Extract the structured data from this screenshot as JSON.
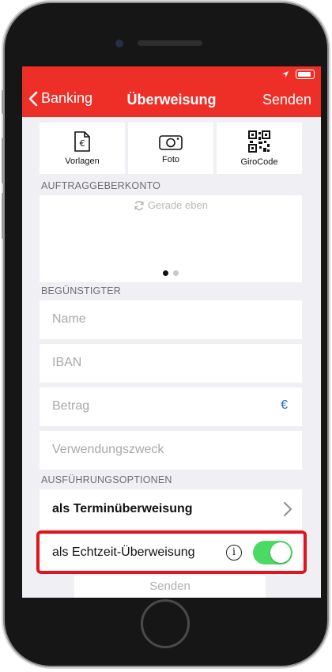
{
  "nav": {
    "back_label": "Banking",
    "title": "Überweisung",
    "send_label": "Senden"
  },
  "tiles": [
    {
      "label": "Vorlagen",
      "icon": "document-euro-icon"
    },
    {
      "label": "Foto",
      "icon": "camera-icon"
    },
    {
      "label": "GiroCode",
      "icon": "qr-code-icon"
    }
  ],
  "sections": {
    "account": "AUFTRAGGEBERKONTO",
    "beneficiary": "BEGÜNSTIGTER",
    "options": "AUSFÜHRUNGSOPTIONEN"
  },
  "account": {
    "sync_text": "Gerade eben",
    "page_count": 2,
    "active_page": 1
  },
  "fields": {
    "name_placeholder": "Name",
    "iban_placeholder": "IBAN",
    "amount_placeholder": "Betrag",
    "currency": "€",
    "purpose_placeholder": "Verwendungszweck"
  },
  "options": {
    "scheduled_label": "als Terminüberweisung",
    "instant_label": "als Echtzeit-Überweisung",
    "instant_enabled": true,
    "info_icon": "i"
  },
  "footer": {
    "send_label": "Senden"
  },
  "colors": {
    "brand": "#ed2f27",
    "toggle_on": "#4cd964",
    "highlight": "#e0141e",
    "currency": "#1a6fd4"
  }
}
